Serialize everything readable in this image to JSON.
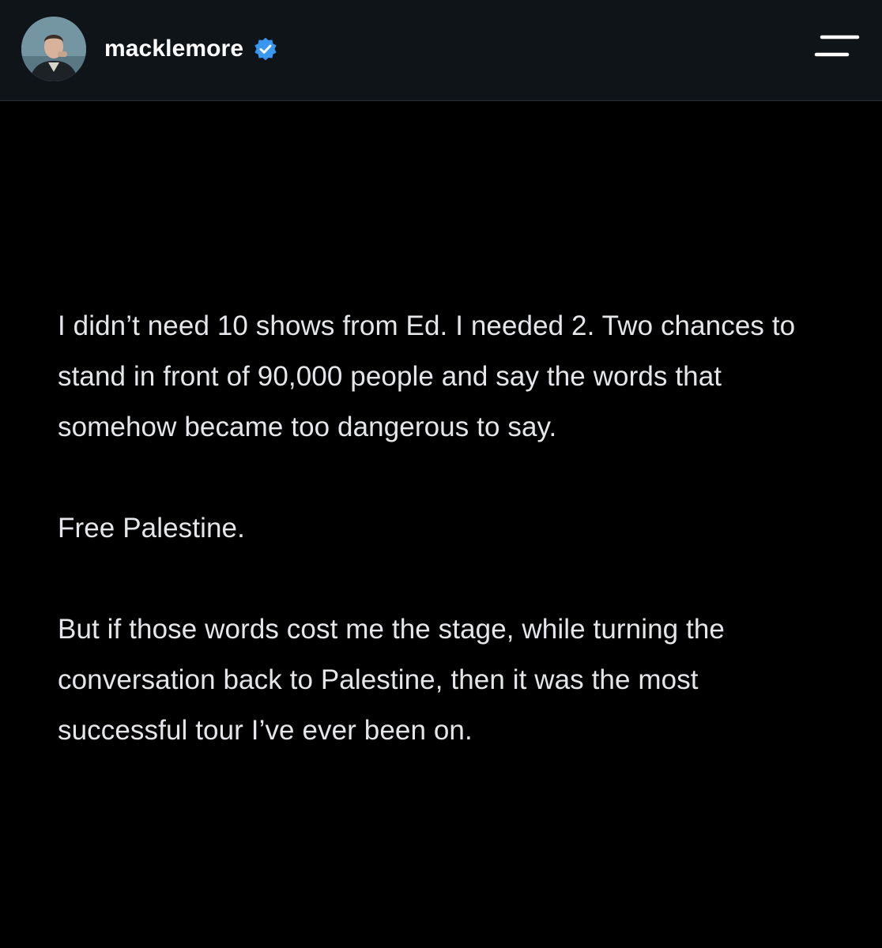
{
  "header": {
    "username": "macklemore",
    "verified_color": "#3897f0",
    "background": "#0f1419",
    "avatar_icon": "profile-avatar",
    "menu_icon": "hamburger-menu-icon"
  },
  "post": {
    "paragraphs": [
      "I didn’t need 10 shows from Ed. I needed 2. Two chances to stand in front of 90,000 people and say the words that somehow became too dangerous to say.",
      "Free Palestine.",
      "But if those words cost me the stage, while turning the conversation back to Palestine, then it was the most successful tour I’ve ever been on."
    ]
  }
}
